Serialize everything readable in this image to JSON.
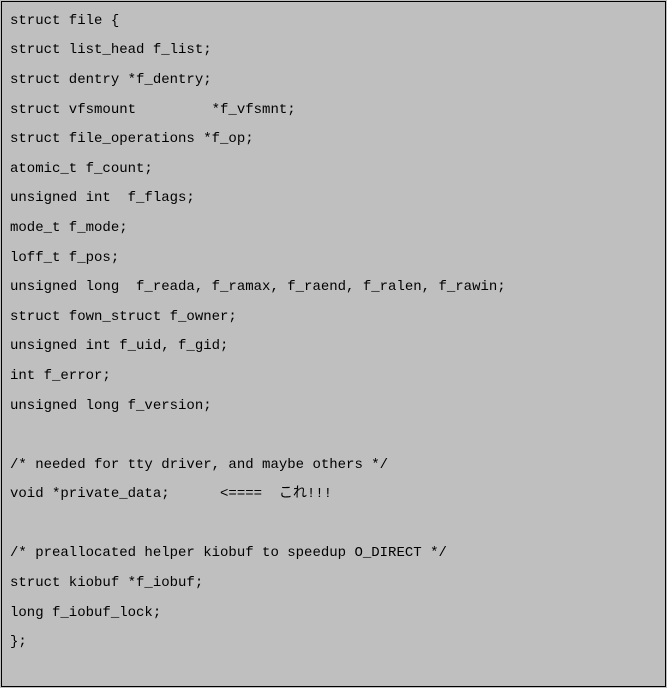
{
  "code": {
    "lines": [
      "struct file {",
      "struct list_head f_list;",
      "struct dentry *f_dentry;",
      "struct vfsmount         *f_vfsmnt;",
      "struct file_operations *f_op;",
      "atomic_t f_count;",
      "unsigned int  f_flags;",
      "mode_t f_mode;",
      "loff_t f_pos;",
      "unsigned long  f_reada, f_ramax, f_raend, f_ralen, f_rawin;",
      "struct fown_struct f_owner;",
      "unsigned int f_uid, f_gid;",
      "int f_error;",
      "unsigned long f_version;",
      "",
      "/* needed for tty driver, and maybe others */",
      "void *private_data;      <====  これ!!!",
      "",
      "/* preallocated helper kiobuf to speedup O_DIRECT */",
      "struct kiobuf *f_iobuf;",
      "long f_iobuf_lock;",
      "};"
    ]
  }
}
